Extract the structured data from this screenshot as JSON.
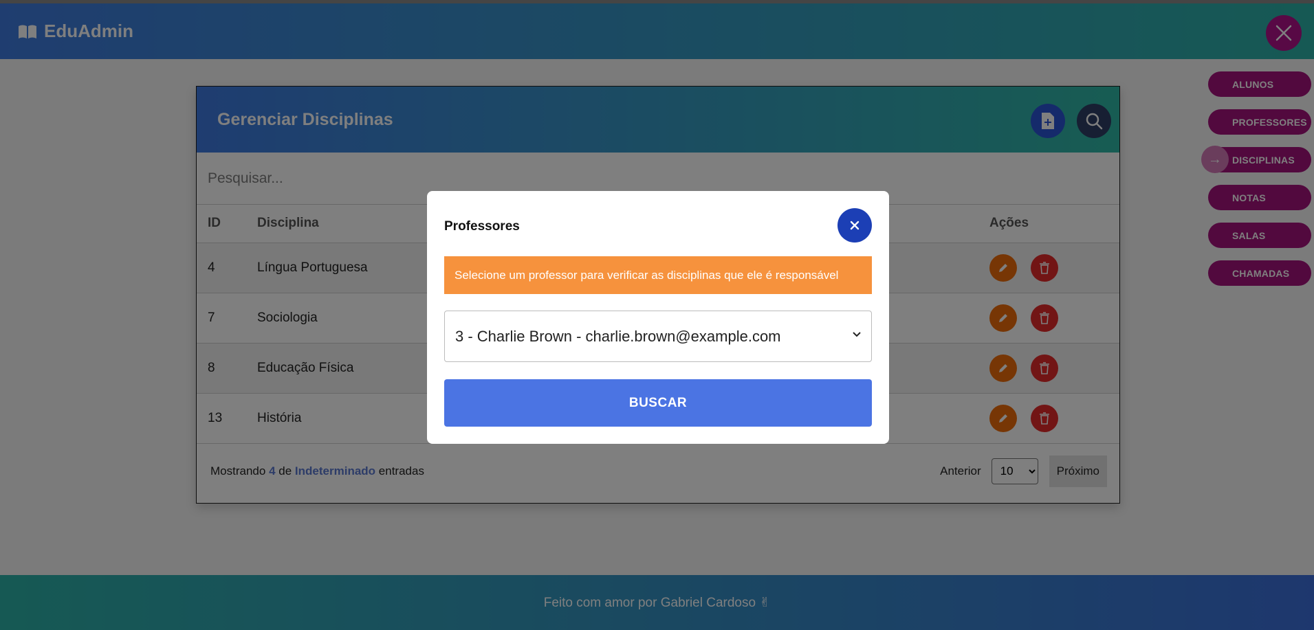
{
  "app": {
    "name": "EduAdmin"
  },
  "nav": {
    "items": [
      {
        "label": "ALUNOS"
      },
      {
        "label": "PROFESSORES"
      },
      {
        "label": "DISCIPLINAS",
        "active": true
      },
      {
        "label": "NOTAS"
      },
      {
        "label": "SALAS"
      },
      {
        "label": "CHAMADAS"
      }
    ]
  },
  "card": {
    "title": "Gerenciar Disciplinas",
    "search_placeholder": "Pesquisar...",
    "columns": {
      "id": "ID",
      "disciplina": "Disciplina",
      "acoes": "Ações"
    },
    "rows": [
      {
        "id": "4",
        "disciplina": "Língua Portuguesa"
      },
      {
        "id": "7",
        "disciplina": "Sociologia"
      },
      {
        "id": "8",
        "disciplina": "Educação Física"
      },
      {
        "id": "13",
        "disciplina": "História"
      }
    ],
    "summary": {
      "prefix": "Mostrando",
      "count": "4",
      "mid": "de",
      "total": "Indeterminado",
      "suffix": "entradas"
    },
    "pager": {
      "prev": "Anterior",
      "page_size": "10",
      "next": "Próximo"
    }
  },
  "footer": {
    "text": "Feito com amor por Gabriel Cardoso ✌"
  },
  "modal": {
    "title": "Professores",
    "alert": "Selecione um professor para verificar as disciplinas que ele é responsável",
    "selected_professor": "3 - Charlie Brown - charlie.brown@example.com",
    "button": "BUSCAR"
  },
  "colors": {
    "header_gradient_start": "#3f7be0",
    "header_gradient_end": "#2db3a8",
    "nav_pill": "#a4127c",
    "alert": "#f6923d",
    "primary_button": "#4b74e3",
    "edit_button": "#ee6d0a",
    "delete_button": "#e52a2a"
  }
}
